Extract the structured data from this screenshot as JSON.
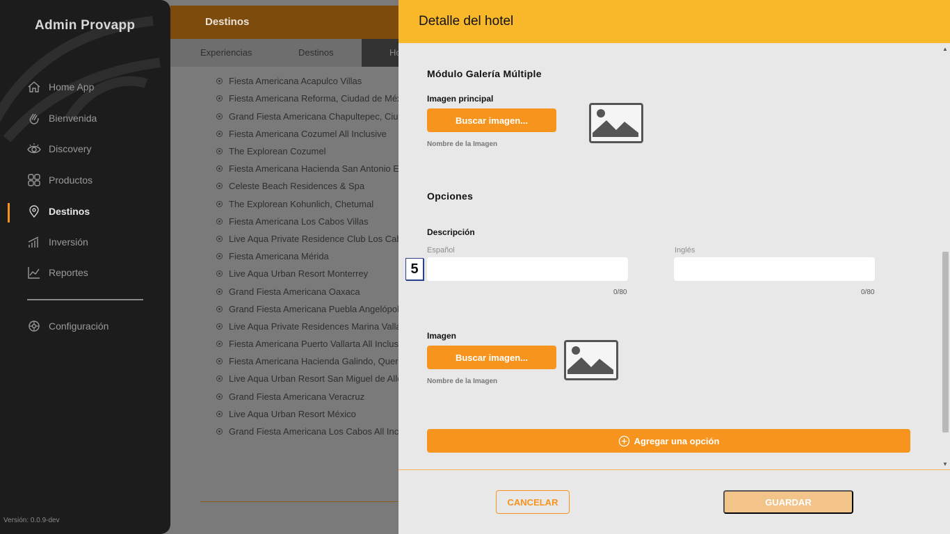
{
  "sidebar": {
    "brand": "Admin Provapp",
    "items": [
      {
        "label": "Home App",
        "icon": "home-icon"
      },
      {
        "label": "Bienvenida",
        "icon": "wave-hand-icon"
      },
      {
        "label": "Discovery",
        "icon": "eye-icon"
      },
      {
        "label": "Productos",
        "icon": "grid-icon"
      },
      {
        "label": "Destinos",
        "icon": "map-pin-icon",
        "active": true
      },
      {
        "label": "Inversión",
        "icon": "bar-chart-icon"
      },
      {
        "label": "Reportes",
        "icon": "line-chart-icon"
      }
    ],
    "settings_label": "Configuración",
    "version": "Versión: 0.0.9-dev"
  },
  "main": {
    "header_title": "Destinos",
    "tabs": [
      "Experiencias",
      "Destinos",
      "Ho"
    ],
    "hotels": [
      "Fiesta Americana Acapulco Villas",
      "Fiesta Americana Reforma, Ciudad de México",
      "Grand Fiesta Americana Chapultepec, Ciudad de México",
      "Fiesta Americana Cozumel All Inclusive",
      "The Explorean Cozumel",
      "Fiesta Americana Hacienda San Antonio El Puente",
      "Celeste Beach Residences & Spa",
      "The Explorean Kohunlich, Chetumal",
      "Fiesta Americana Los Cabos Villas",
      "Live Aqua Private Residence Club Los Cabos",
      "Fiesta Americana Mérida",
      "Live Aqua Urban Resort Monterrey",
      "Grand Fiesta Americana Oaxaca",
      "Grand Fiesta Americana Puebla Angelópolis",
      "Live Aqua Private Residences Marina Vallarta",
      "Fiesta Americana Puerto Vallarta All Inclusive",
      "Fiesta Americana Hacienda Galindo, Querétaro",
      "Live Aqua Urban Resort San Miguel de Allende",
      "Grand Fiesta Americana Veracruz",
      "Live Aqua Urban Resort México",
      "Grand Fiesta Americana Los Cabos All Inclusive"
    ]
  },
  "drawer": {
    "title": "Detalle del hotel",
    "gallery": {
      "section_title": "Módulo Galería Múltiple",
      "main_image_label": "Imagen principal",
      "search_button": "Buscar imagen...",
      "image_name_hint": "Nombre de la Imagen"
    },
    "options": {
      "section_title": "Opciones",
      "description_label": "Descripción",
      "spanish_label": "Español",
      "english_label": "Inglés",
      "spanish_value": "",
      "english_value": "",
      "spanish_counter": "0/80",
      "english_counter": "0/80",
      "image_label": "Imagen",
      "search_button": "Buscar imagen...",
      "image_name_hint": "Nombre de la Imagen",
      "add_option_button": "Agregar una opción"
    },
    "badge": "5",
    "cancel_button": "CANCELAR",
    "save_button": "GUARDAR"
  },
  "colors": {
    "accent": "#f7941d",
    "header_yellow": "#f9b829",
    "sidebar_bg": "#1c1c1c",
    "save_disabled": "#f2c48a"
  }
}
